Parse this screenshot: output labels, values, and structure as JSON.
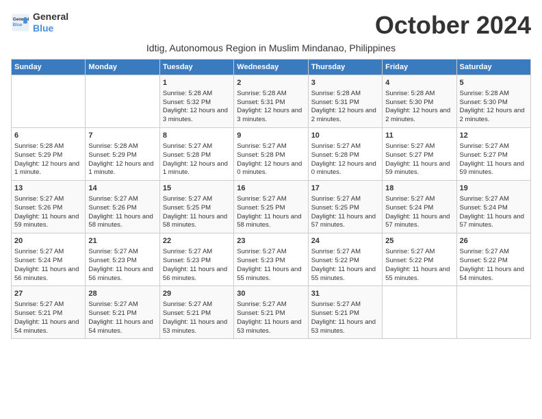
{
  "logo": {
    "line1": "General",
    "line2": "Blue"
  },
  "title": "October 2024",
  "subtitle": "Idtig, Autonomous Region in Muslim Mindanao, Philippines",
  "headers": [
    "Sunday",
    "Monday",
    "Tuesday",
    "Wednesday",
    "Thursday",
    "Friday",
    "Saturday"
  ],
  "weeks": [
    [
      {
        "day": "",
        "lines": []
      },
      {
        "day": "",
        "lines": []
      },
      {
        "day": "1",
        "lines": [
          "Sunrise: 5:28 AM",
          "Sunset: 5:32 PM",
          "Daylight: 12 hours and 3 minutes."
        ]
      },
      {
        "day": "2",
        "lines": [
          "Sunrise: 5:28 AM",
          "Sunset: 5:31 PM",
          "Daylight: 12 hours and 3 minutes."
        ]
      },
      {
        "day": "3",
        "lines": [
          "Sunrise: 5:28 AM",
          "Sunset: 5:31 PM",
          "Daylight: 12 hours and 2 minutes."
        ]
      },
      {
        "day": "4",
        "lines": [
          "Sunrise: 5:28 AM",
          "Sunset: 5:30 PM",
          "Daylight: 12 hours and 2 minutes."
        ]
      },
      {
        "day": "5",
        "lines": [
          "Sunrise: 5:28 AM",
          "Sunset: 5:30 PM",
          "Daylight: 12 hours and 2 minutes."
        ]
      }
    ],
    [
      {
        "day": "6",
        "lines": [
          "Sunrise: 5:28 AM",
          "Sunset: 5:29 PM",
          "Daylight: 12 hours and 1 minute."
        ]
      },
      {
        "day": "7",
        "lines": [
          "Sunrise: 5:28 AM",
          "Sunset: 5:29 PM",
          "Daylight: 12 hours and 1 minute."
        ]
      },
      {
        "day": "8",
        "lines": [
          "Sunrise: 5:27 AM",
          "Sunset: 5:28 PM",
          "Daylight: 12 hours and 1 minute."
        ]
      },
      {
        "day": "9",
        "lines": [
          "Sunrise: 5:27 AM",
          "Sunset: 5:28 PM",
          "Daylight: 12 hours and 0 minutes."
        ]
      },
      {
        "day": "10",
        "lines": [
          "Sunrise: 5:27 AM",
          "Sunset: 5:28 PM",
          "Daylight: 12 hours and 0 minutes."
        ]
      },
      {
        "day": "11",
        "lines": [
          "Sunrise: 5:27 AM",
          "Sunset: 5:27 PM",
          "Daylight: 11 hours and 59 minutes."
        ]
      },
      {
        "day": "12",
        "lines": [
          "Sunrise: 5:27 AM",
          "Sunset: 5:27 PM",
          "Daylight: 11 hours and 59 minutes."
        ]
      }
    ],
    [
      {
        "day": "13",
        "lines": [
          "Sunrise: 5:27 AM",
          "Sunset: 5:26 PM",
          "Daylight: 11 hours and 59 minutes."
        ]
      },
      {
        "day": "14",
        "lines": [
          "Sunrise: 5:27 AM",
          "Sunset: 5:26 PM",
          "Daylight: 11 hours and 58 minutes."
        ]
      },
      {
        "day": "15",
        "lines": [
          "Sunrise: 5:27 AM",
          "Sunset: 5:25 PM",
          "Daylight: 11 hours and 58 minutes."
        ]
      },
      {
        "day": "16",
        "lines": [
          "Sunrise: 5:27 AM",
          "Sunset: 5:25 PM",
          "Daylight: 11 hours and 58 minutes."
        ]
      },
      {
        "day": "17",
        "lines": [
          "Sunrise: 5:27 AM",
          "Sunset: 5:25 PM",
          "Daylight: 11 hours and 57 minutes."
        ]
      },
      {
        "day": "18",
        "lines": [
          "Sunrise: 5:27 AM",
          "Sunset: 5:24 PM",
          "Daylight: 11 hours and 57 minutes."
        ]
      },
      {
        "day": "19",
        "lines": [
          "Sunrise: 5:27 AM",
          "Sunset: 5:24 PM",
          "Daylight: 11 hours and 57 minutes."
        ]
      }
    ],
    [
      {
        "day": "20",
        "lines": [
          "Sunrise: 5:27 AM",
          "Sunset: 5:24 PM",
          "Daylight: 11 hours and 56 minutes."
        ]
      },
      {
        "day": "21",
        "lines": [
          "Sunrise: 5:27 AM",
          "Sunset: 5:23 PM",
          "Daylight: 11 hours and 56 minutes."
        ]
      },
      {
        "day": "22",
        "lines": [
          "Sunrise: 5:27 AM",
          "Sunset: 5:23 PM",
          "Daylight: 11 hours and 56 minutes."
        ]
      },
      {
        "day": "23",
        "lines": [
          "Sunrise: 5:27 AM",
          "Sunset: 5:23 PM",
          "Daylight: 11 hours and 55 minutes."
        ]
      },
      {
        "day": "24",
        "lines": [
          "Sunrise: 5:27 AM",
          "Sunset: 5:22 PM",
          "Daylight: 11 hours and 55 minutes."
        ]
      },
      {
        "day": "25",
        "lines": [
          "Sunrise: 5:27 AM",
          "Sunset: 5:22 PM",
          "Daylight: 11 hours and 55 minutes."
        ]
      },
      {
        "day": "26",
        "lines": [
          "Sunrise: 5:27 AM",
          "Sunset: 5:22 PM",
          "Daylight: 11 hours and 54 minutes."
        ]
      }
    ],
    [
      {
        "day": "27",
        "lines": [
          "Sunrise: 5:27 AM",
          "Sunset: 5:21 PM",
          "Daylight: 11 hours and 54 minutes."
        ]
      },
      {
        "day": "28",
        "lines": [
          "Sunrise: 5:27 AM",
          "Sunset: 5:21 PM",
          "Daylight: 11 hours and 54 minutes."
        ]
      },
      {
        "day": "29",
        "lines": [
          "Sunrise: 5:27 AM",
          "Sunset: 5:21 PM",
          "Daylight: 11 hours and 53 minutes."
        ]
      },
      {
        "day": "30",
        "lines": [
          "Sunrise: 5:27 AM",
          "Sunset: 5:21 PM",
          "Daylight: 11 hours and 53 minutes."
        ]
      },
      {
        "day": "31",
        "lines": [
          "Sunrise: 5:27 AM",
          "Sunset: 5:21 PM",
          "Daylight: 11 hours and 53 minutes."
        ]
      },
      {
        "day": "",
        "lines": []
      },
      {
        "day": "",
        "lines": []
      }
    ]
  ]
}
